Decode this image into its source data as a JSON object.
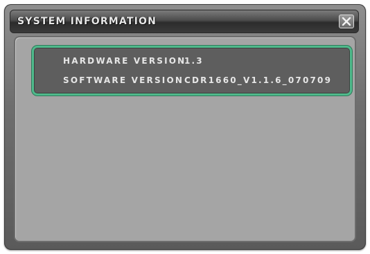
{
  "window": {
    "title": "SYSTEM INFORMATION",
    "close_icon": "close-icon"
  },
  "info": {
    "rows": [
      {
        "label": "HARDWARE VERSION",
        "value": "1.3"
      },
      {
        "label": "SOFTWARE VERSION",
        "value": "CDR1660_V1.1.6_070709"
      }
    ]
  },
  "colors": {
    "panel_border": "#4fb98b",
    "panel_background": "#5e5e5e",
    "content_background": "#a5a5a5"
  }
}
